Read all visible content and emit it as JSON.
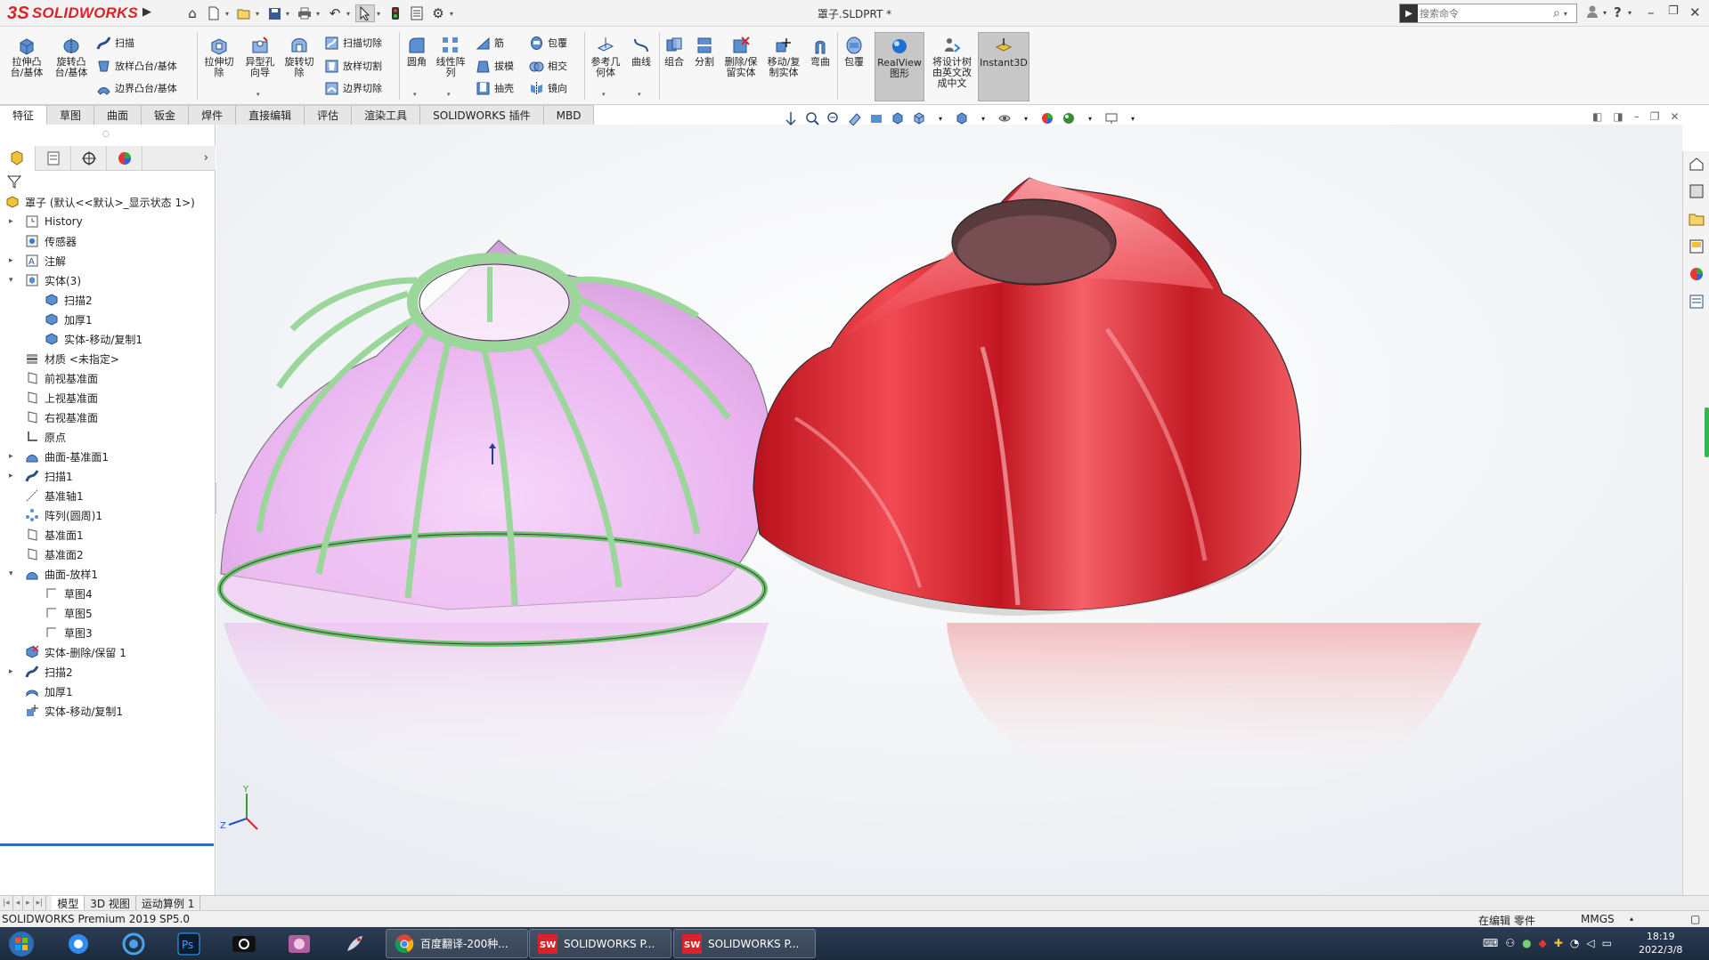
{
  "app": {
    "logo_prefix": "3S",
    "logo_text": "SOLIDWORKS",
    "document_title": "罩子.SLDPRT *",
    "search_placeholder": "搜索命令"
  },
  "commands": {
    "extrude_boss": "拉伸凸\n台/基体",
    "revolve_boss": "旋转凸\n台/基体",
    "sweep": "扫描",
    "loft": "放样凸台/基体",
    "boundary": "边界凸台/基体",
    "extrude_cut": "拉伸切\n除",
    "hole_wizard": "异型孔\n向导",
    "revolve_cut": "旋转切\n除",
    "swept_cut": "扫描切除",
    "lofted_cut": "放样切割",
    "boundary_cut": "边界切除",
    "fillet": "圆角",
    "linear_pattern": "线性阵\n列",
    "rib": "筋",
    "draft": "拔模",
    "shell": "抽壳",
    "wrap": "包覆",
    "intersect": "相交",
    "mirror": "镜向",
    "ref_geometry": "参考几\n何体",
    "curves": "曲线",
    "combine": "组合",
    "split": "分割",
    "delete_keep": "删除/保\n留实体",
    "move_copy": "移动/复\n制实体",
    "flex": "弯曲",
    "wrap2": "包覆",
    "realview": "RealView\n图形",
    "translate": "将设计树\n由英文改\n成中文",
    "instant3d": "Instant3D"
  },
  "tabs": [
    "特征",
    "草图",
    "曲面",
    "钣金",
    "焊件",
    "直接编辑",
    "评估",
    "渲染工具",
    "SOLIDWORKS 插件",
    "MBD"
  ],
  "tree": [
    {
      "label": "罩子  (默认<<默认>_显示状态 1>)",
      "level": 0,
      "expand": "",
      "icon": "part"
    },
    {
      "label": "History",
      "level": 1,
      "expand": "▸",
      "icon": "history"
    },
    {
      "label": "传感器",
      "level": 1,
      "expand": "",
      "icon": "sensor"
    },
    {
      "label": "注解",
      "level": 1,
      "expand": "▸",
      "icon": "annot"
    },
    {
      "label": "实体(3)",
      "level": 1,
      "expand": "▾",
      "icon": "solids"
    },
    {
      "label": "扫描2",
      "level": 2,
      "expand": "",
      "icon": "body"
    },
    {
      "label": "加厚1",
      "level": 2,
      "expand": "",
      "icon": "body"
    },
    {
      "label": "实体-移动/复制1",
      "level": 2,
      "expand": "",
      "icon": "body"
    },
    {
      "label": "材质 <未指定>",
      "level": 1,
      "expand": "",
      "icon": "material"
    },
    {
      "label": "前视基准面",
      "level": 1,
      "expand": "",
      "icon": "plane"
    },
    {
      "label": "上视基准面",
      "level": 1,
      "expand": "",
      "icon": "plane"
    },
    {
      "label": "右视基准面",
      "level": 1,
      "expand": "",
      "icon": "plane"
    },
    {
      "label": "原点",
      "level": 1,
      "expand": "",
      "icon": "origin"
    },
    {
      "label": "曲面-基准面1",
      "level": 1,
      "expand": "▸",
      "icon": "surface"
    },
    {
      "label": "扫描1",
      "level": 1,
      "expand": "▸",
      "icon": "sweep"
    },
    {
      "label": "基准轴1",
      "level": 1,
      "expand": "",
      "icon": "axis"
    },
    {
      "label": "阵列(圆周)1",
      "level": 1,
      "expand": "",
      "icon": "pattern"
    },
    {
      "label": "基准面1",
      "level": 1,
      "expand": "",
      "icon": "plane"
    },
    {
      "label": "基准面2",
      "level": 1,
      "expand": "",
      "icon": "plane"
    },
    {
      "label": "曲面-放样1",
      "level": 1,
      "expand": "▾",
      "icon": "surface"
    },
    {
      "label": "草图4",
      "level": 2,
      "expand": "",
      "icon": "sketch"
    },
    {
      "label": "草图5",
      "level": 2,
      "expand": "",
      "icon": "sketch"
    },
    {
      "label": "草图3",
      "level": 2,
      "expand": "",
      "icon": "sketch"
    },
    {
      "label": "实体-删除/保留 1",
      "level": 1,
      "expand": "",
      "icon": "delete"
    },
    {
      "label": "扫描2",
      "level": 1,
      "expand": "▸",
      "icon": "sweep"
    },
    {
      "label": "加厚1",
      "level": 1,
      "expand": "",
      "icon": "thicken"
    },
    {
      "label": "实体-移动/复制1",
      "level": 1,
      "expand": "",
      "icon": "move"
    }
  ],
  "bottom_tabs": [
    "模型",
    "3D 视图",
    "运动算例 1"
  ],
  "status": {
    "product": "SOLIDWORKS Premium 2019 SP5.0",
    "mode": "在编辑 零件",
    "units": "MMGS"
  },
  "taskbar": {
    "app1": "百度翻译-200种...",
    "app2": "SOLIDWORKS P...",
    "app3": "SOLIDWORKS P...",
    "time": "18:19",
    "date": "2022/3/8"
  },
  "colors": {
    "brand_red": "#d8232a",
    "pink_shell": "#e8a6ec",
    "green_frame": "#8fd28f",
    "red_shell": "#e8333d"
  },
  "triad": {
    "y": "Y",
    "z": "Z"
  }
}
